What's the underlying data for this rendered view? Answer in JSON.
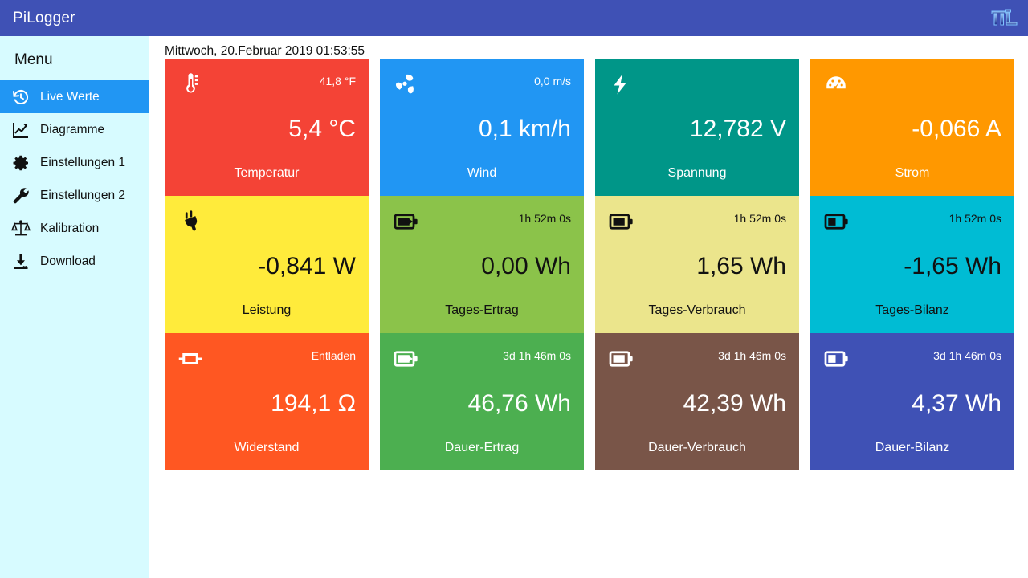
{
  "app": {
    "title": "PiLogger",
    "logo_text": "πL",
    "topbar_color": "#3f51b5"
  },
  "sidebar": {
    "title": "Menu",
    "bg_color": "#d7fbff",
    "active_color": "#2196f3",
    "items": [
      {
        "label": "Live Werte",
        "icon": "history-icon",
        "active": true
      },
      {
        "label": "Diagramme",
        "icon": "chart-line-icon",
        "active": false
      },
      {
        "label": "Einstellungen 1",
        "icon": "gear-icon",
        "active": false
      },
      {
        "label": "Einstellungen 2",
        "icon": "wrench-icon",
        "active": false
      },
      {
        "label": "Kalibration",
        "icon": "scales-icon",
        "active": false
      },
      {
        "label": "Download",
        "icon": "download-icon",
        "active": false
      }
    ]
  },
  "main": {
    "datetime": "Mittwoch, 20.Februar 2019 01:53:55",
    "tiles": [
      {
        "name": "Temperatur",
        "sub": "41,8 °F",
        "value": "5,4 °C",
        "icon": "thermometer-icon",
        "bg": "#f44336",
        "fg": "#ffffff"
      },
      {
        "name": "Wind",
        "sub": "0,0 m/s",
        "value": "0,1 km/h",
        "icon": "fan-icon",
        "bg": "#2196f3",
        "fg": "#ffffff"
      },
      {
        "name": "Spannung",
        "sub": "",
        "value": "12,782 V",
        "icon": "bolt-icon",
        "bg": "#009688",
        "fg": "#ffffff"
      },
      {
        "name": "Strom",
        "sub": "",
        "value": "-0,066 A",
        "icon": "gauge-icon",
        "bg": "#ff9800",
        "fg": "#ffffff"
      },
      {
        "name": "Leistung",
        "sub": "",
        "value": "-0,841 W",
        "icon": "plug-icon",
        "bg": "#ffeb3b",
        "fg": "#111111"
      },
      {
        "name": "Tages-Ertrag",
        "sub": "1h 52m 0s",
        "value": "0,00 Wh",
        "icon": "battery-in-icon",
        "bg": "#8bc34a",
        "fg": "#111111"
      },
      {
        "name": "Tages-Verbrauch",
        "sub": "1h 52m 0s",
        "value": "1,65 Wh",
        "icon": "battery-out-icon",
        "bg": "#ebe58c",
        "fg": "#111111"
      },
      {
        "name": "Tages-Bilanz",
        "sub": "1h 52m 0s",
        "value": "-1,65 Wh",
        "icon": "battery-level-icon",
        "bg": "#00bcd4",
        "fg": "#111111"
      },
      {
        "name": "Widerstand",
        "sub": "Entladen",
        "value": "194,1 Ω",
        "icon": "resistor-icon",
        "bg": "#ff5722",
        "fg": "#ffffff"
      },
      {
        "name": "Dauer-Ertrag",
        "sub": "3d 1h 46m 0s",
        "value": "46,76 Wh",
        "icon": "battery-in-icon",
        "bg": "#4caf50",
        "fg": "#ffffff"
      },
      {
        "name": "Dauer-Verbrauch",
        "sub": "3d 1h 46m 0s",
        "value": "42,39 Wh",
        "icon": "battery-out-icon",
        "bg": "#795548",
        "fg": "#ffffff"
      },
      {
        "name": "Dauer-Bilanz",
        "sub": "3d 1h 46m 0s",
        "value": "4,37 Wh",
        "icon": "battery-level-icon",
        "bg": "#3f51b5",
        "fg": "#ffffff"
      }
    ]
  }
}
